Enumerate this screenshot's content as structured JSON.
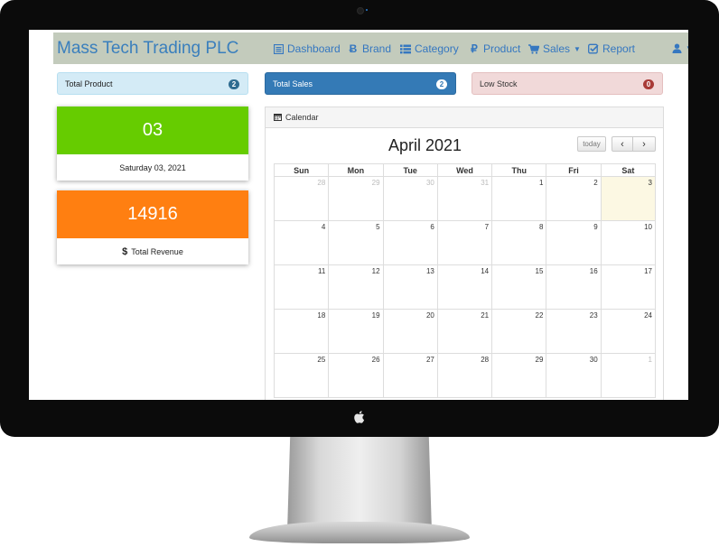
{
  "app": {
    "title": "Mass Tech Trading PLC"
  },
  "nav": {
    "items": [
      {
        "label": "Dashboard",
        "icon": "dashboard-icon"
      },
      {
        "label": "Brand",
        "icon": "bitcoin-icon"
      },
      {
        "label": "Category",
        "icon": "list-icon"
      },
      {
        "label": "Product",
        "icon": "ruble-icon"
      },
      {
        "label": "Sales",
        "icon": "cart-icon",
        "dropdown": true
      },
      {
        "label": "Report",
        "icon": "check-square-icon"
      }
    ],
    "user_icon": "user-icon"
  },
  "stats": {
    "total_product": {
      "label": "Total Product",
      "count": "2",
      "color": "#d4ebf6"
    },
    "total_sales": {
      "label": "Total Sales",
      "count": "2",
      "color": "#347ab6"
    },
    "low_stock": {
      "label": "Low Stock",
      "count": "0",
      "color": "#f1d9d9"
    }
  },
  "cards": {
    "date": {
      "value": "03",
      "caption": "Saturday 03, 2021",
      "color": "#66cc00"
    },
    "revenue": {
      "value": "14916",
      "caption": "Total Revenue",
      "icon": "dollar-icon",
      "color": "#ff7f11"
    }
  },
  "calendar": {
    "panel_title": "Calendar",
    "month_title": "April 2021",
    "today_label": "today",
    "prev_icon": "chevron-left-icon",
    "next_icon": "chevron-right-icon",
    "weekdays": [
      "Sun",
      "Mon",
      "Tue",
      "Wed",
      "Thu",
      "Fri",
      "Sat"
    ],
    "weeks": [
      [
        "28",
        "29",
        "30",
        "31",
        "1",
        "2",
        "3"
      ],
      [
        "4",
        "5",
        "6",
        "7",
        "8",
        "9",
        "10"
      ],
      [
        "11",
        "12",
        "13",
        "14",
        "15",
        "16",
        "17"
      ],
      [
        "18",
        "19",
        "20",
        "21",
        "22",
        "23",
        "24"
      ],
      [
        "25",
        "26",
        "27",
        "28",
        "29",
        "30",
        "1"
      ]
    ],
    "other_month_cells": [
      "0-0",
      "0-1",
      "0-2",
      "0-3",
      "4-6"
    ],
    "today_cell": "0-6",
    "today_highlight": "#fcf8e3"
  }
}
